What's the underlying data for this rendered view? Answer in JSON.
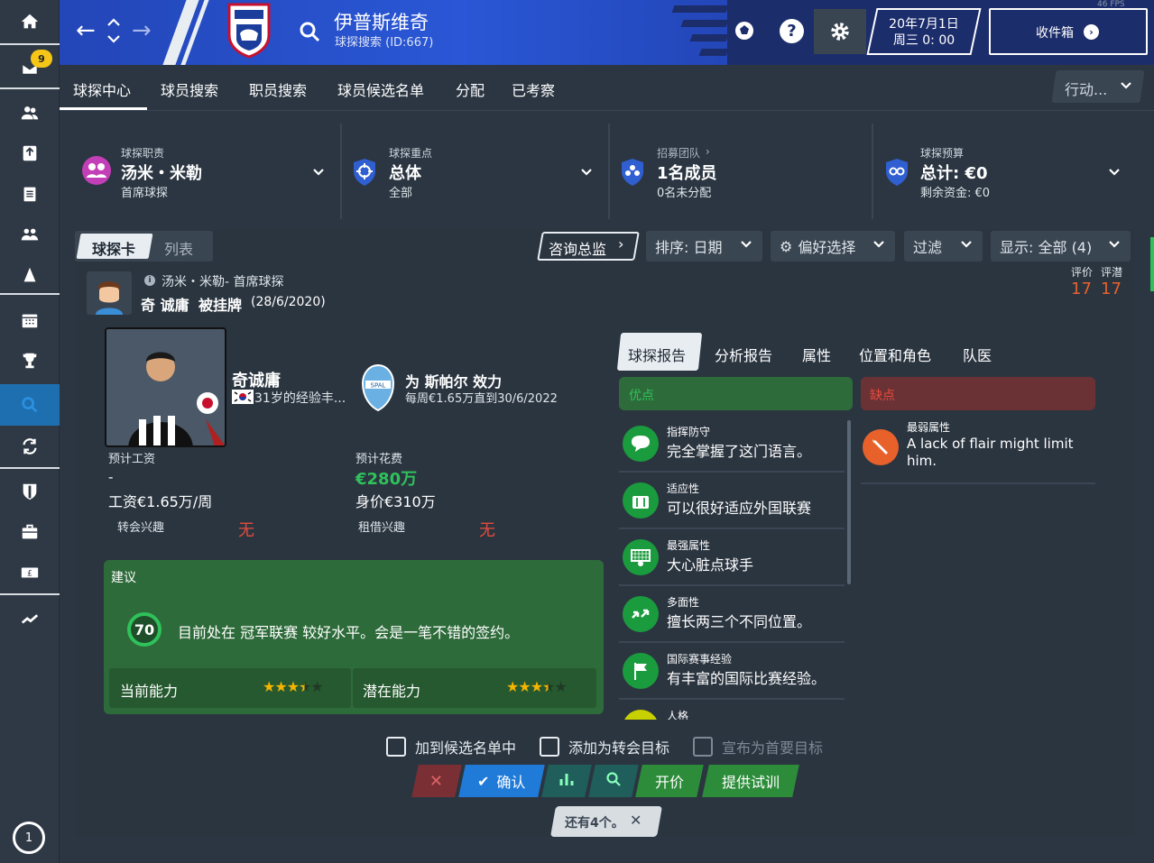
{
  "sidebar": {
    "badge_count": "9",
    "icons": [
      "home-icon",
      "inbox-icon",
      "squad-icon",
      "training-icon",
      "clipboard-icon",
      "staff-icon",
      "tactics-icon",
      "calendar-icon",
      "trophy-icon",
      "search-icon",
      "transfer-icon",
      "club-icon",
      "briefcase-icon",
      "finance-icon",
      "trend-icon"
    ],
    "bottom_counter": "1"
  },
  "topbar": {
    "club_name": "伊普斯维奇",
    "sub": "球探搜索 (ID:667)",
    "date_line1": "20年7月1日",
    "date_line2": "周三 0: 00",
    "inbox_label": "收件箱",
    "fps": "46 FPS"
  },
  "tabs": [
    "球探中心",
    "球员搜索",
    "职员搜索",
    "球员候选名单",
    "分配",
    "已考察"
  ],
  "action_label": "行动...",
  "header": {
    "duty": {
      "label": "球探职责",
      "name": "汤米・米勒",
      "sub": "首席球探"
    },
    "focus": {
      "label": "球探重点",
      "name": "总体",
      "sub": "全部"
    },
    "team": {
      "label": "招募团队",
      "name": "1名成员",
      "sub": "0名未分配"
    },
    "budget": {
      "label": "球探预算",
      "name": "总计: €0",
      "sub": "剩余资金: €0"
    }
  },
  "controls": {
    "view_card": "球探卡",
    "view_list": "列表",
    "consult": "咨询总监",
    "sort": "排序: 日期",
    "prefs": "偏好选择",
    "filter": "过滤",
    "display": "显示: 全部 (4)"
  },
  "report": {
    "scout_line": "汤米・米勒- 首席球探",
    "title_player": "奇 诚庸",
    "title_status": "被挂牌",
    "title_date": "(28/6/2020)",
    "rating_label": "评价",
    "potential_label": "评潜",
    "rating": "17",
    "potential": "17"
  },
  "player": {
    "name": "奇诚庸",
    "desc": "31岁的经验丰...",
    "club_line": "为 斯帕尔 效力",
    "contract": "每周€1.65万直到30/6/2022",
    "wage_label": "预计工资",
    "wage_value": "-",
    "wage_current": "工资€1.65万/周",
    "cost_label": "预计花费",
    "cost_value": "€280万",
    "value": "身价€310万",
    "transfer_interest_label": "转会兴趣",
    "transfer_interest": "无",
    "loan_interest_label": "租借兴趣",
    "loan_interest": "无"
  },
  "advice": {
    "label": "建议",
    "score": "70",
    "text": "目前处在 冠军联赛 较好水平。会是一笔不错的签约。",
    "current_label": "当前能力",
    "potential_label": "潜在能力",
    "current_stars": 3.5,
    "potential_stars": 3.5
  },
  "report_tabs": [
    "球探报告",
    "分析报告",
    "属性",
    "位置和角色",
    "队医"
  ],
  "pros_label": "优点",
  "cons_label": "缺点",
  "pros": [
    {
      "title": "指挥防守",
      "text": "完全掌握了这门语言。",
      "icon": "chat-icon"
    },
    {
      "title": "适应性",
      "text": "可以很好适应外国联赛",
      "icon": "luggage-icon"
    },
    {
      "title": "最强属性",
      "text": "大心脏点球手",
      "icon": "goal-icon"
    },
    {
      "title": "多面性",
      "text": "擅长两三个不同位置。",
      "icon": "arrows-icon"
    },
    {
      "title": "国际赛事经验",
      "text": "有丰富的国际比赛经验。",
      "icon": "flag-icon"
    },
    {
      "title": "人格",
      "text": "",
      "icon": "person-icon"
    }
  ],
  "cons": [
    {
      "title": "最弱属性",
      "text": "A lack of flair might limit him.",
      "icon": "brush-icon"
    }
  ],
  "checkboxes": [
    "加到候选名单中",
    "添加为转会目标",
    "宣布为首要目标"
  ],
  "buttons": {
    "confirm": "确认",
    "bid": "开价",
    "trial": "提供试训"
  },
  "remaining": "还有4个。",
  "colors": {
    "accent_blue": "#2a57d6",
    "green": "#1a9b3d",
    "red": "#e54b3c",
    "orange": "#e8612b"
  }
}
